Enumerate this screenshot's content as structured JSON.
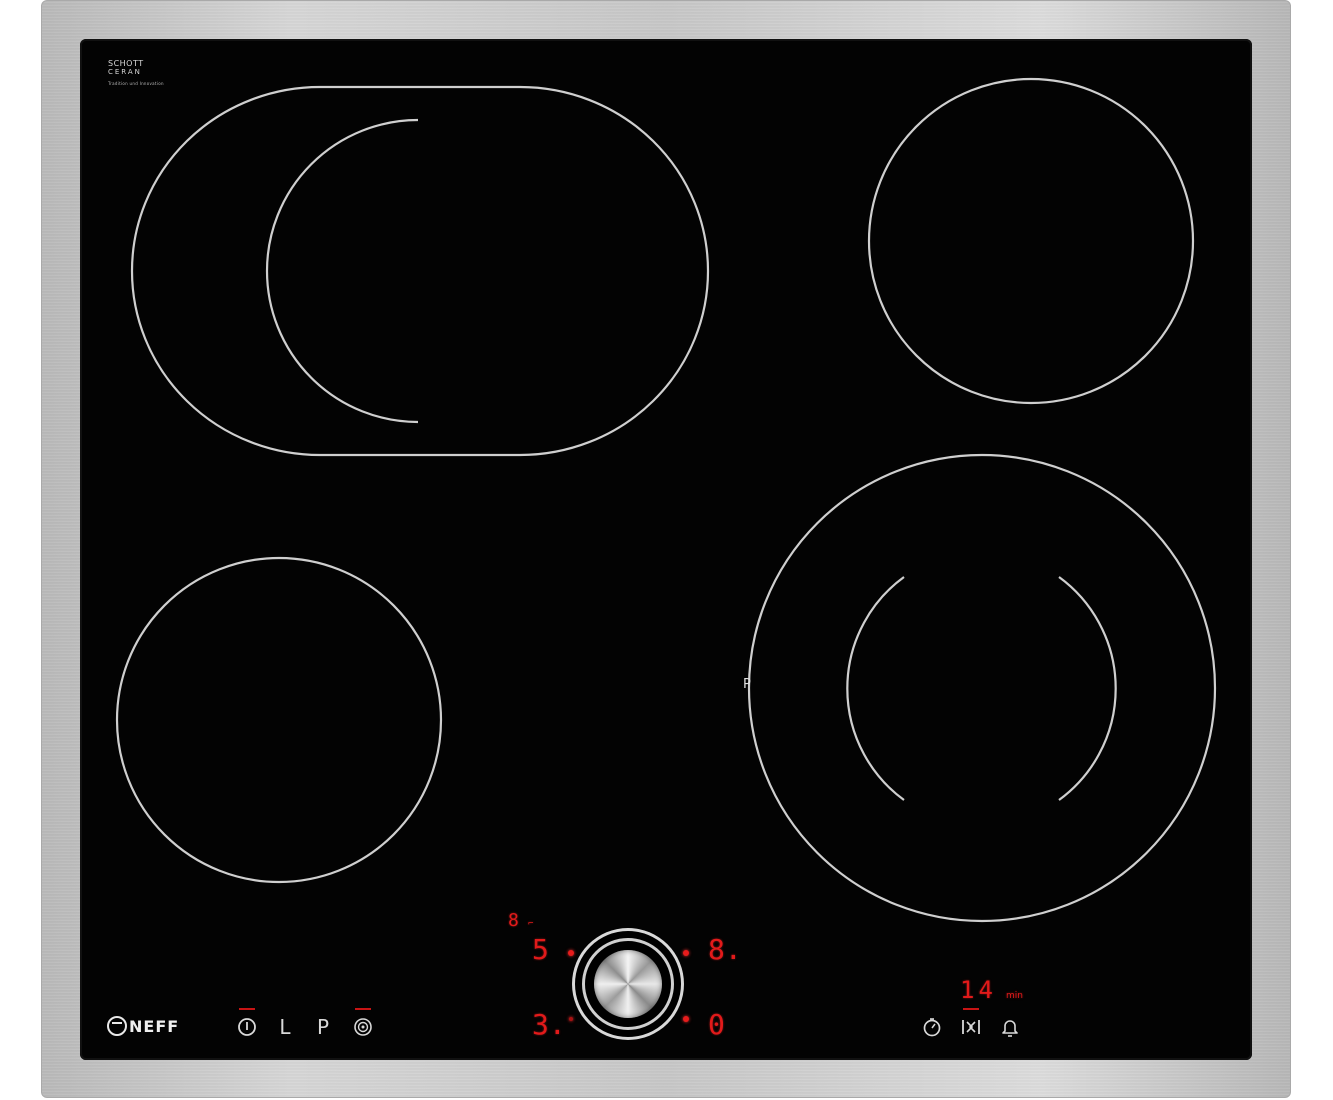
{
  "brand": {
    "glass_maker_line1": "SCHOTT",
    "glass_maker_line2": "CERAN",
    "glass_small_print": "Tradition und Innovation",
    "hob_brand": "NEFF"
  },
  "colors": {
    "glass": "#030303",
    "frame": "#c8c8c8",
    "zone_outline": "#cfcfcf",
    "indicator_red": "#e21a1a"
  },
  "zones": {
    "rear_left": "oval-dual-zone",
    "rear_right": "single-zone",
    "front_left": "single-zone",
    "front_right": "dual-circuit-zone",
    "front_right_mark": "P"
  },
  "control_panel": {
    "left_touch_keys": [
      {
        "icon": "power-icon",
        "label": ""
      },
      {
        "icon": "lock-icon",
        "label": "L"
      },
      {
        "icon": "power-boost-icon",
        "label": "P"
      },
      {
        "icon": "wipe-protection-icon",
        "label": ""
      }
    ],
    "knob_display": {
      "top_left_small": "8",
      "top_left_small2": "⌐",
      "top_left_level": "5",
      "top_right_level": "8.",
      "bottom_left_level": "3.",
      "bottom_right_level": "0"
    },
    "timer": {
      "value": "14",
      "unit": "min"
    },
    "right_touch_keys": [
      {
        "icon": "timer-icon"
      },
      {
        "icon": "timer-adjust-icon"
      },
      {
        "icon": "bell-icon"
      }
    ]
  }
}
